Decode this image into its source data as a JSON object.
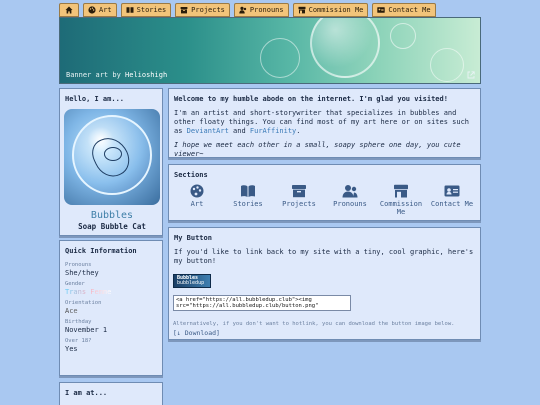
{
  "nav": [
    {
      "label": "",
      "icon": "home-icon"
    },
    {
      "label": "Art",
      "icon": "palette-icon"
    },
    {
      "label": "Stories",
      "icon": "book-icon"
    },
    {
      "label": "Projects",
      "icon": "box-icon"
    },
    {
      "label": "Pronouns",
      "icon": "people-icon"
    },
    {
      "label": "Commission Me",
      "icon": "store-icon"
    },
    {
      "label": "Contact Me",
      "icon": "id-card-icon"
    }
  ],
  "banner": {
    "credit_prefix": "Banner art by",
    "credit_name": "Helioshigh"
  },
  "profile": {
    "heading": "Hello, I am...",
    "name": "Bubbles",
    "subtitle": "Soap Bubble Cat"
  },
  "quick_info": {
    "heading": "Quick Information",
    "items": [
      {
        "key": "Pronouns",
        "value": "She/they"
      },
      {
        "key": "Gender",
        "value": "Trans Femme"
      },
      {
        "key": "Orientation",
        "value": "Ace"
      },
      {
        "key": "Birthday",
        "value": "November 1"
      },
      {
        "key": "Over 18?",
        "value": "Yes"
      }
    ]
  },
  "iam": {
    "heading": "I am at..."
  },
  "welcome": {
    "heading": "Welcome to my humble abode on the internet. I'm glad you visited!",
    "p1_a": "I'm an artist and short-storywriter that specializes in bubbles and other floaty things. You can find most of my art here or on sites such as",
    "link1": "DeviantArt",
    "and": "and",
    "link2": "FurAffinity",
    "p1_end": ".",
    "p2": "I hope we meet each other in a small, soapy sphere one day, you cute viewer~"
  },
  "sections": {
    "heading": "Sections",
    "items": [
      {
        "label": "Art",
        "icon": "palette-icon"
      },
      {
        "label": "Stories",
        "icon": "book-icon"
      },
      {
        "label": "Projects",
        "icon": "box-icon"
      },
      {
        "label": "Pronouns",
        "icon": "people-icon"
      },
      {
        "label": "Commission Me",
        "icon": "store-icon"
      },
      {
        "label": "Contact Me",
        "icon": "id-card-icon"
      }
    ]
  },
  "mybutton": {
    "heading": "My Button",
    "text": "If you'd like to link back to my site with a tiny, cool graphic, here's my button!",
    "img_line1": "Bubbles",
    "img_line2": "bubbledup",
    "code": "<a href=\"https://all.bubbledup.club\"><img src=\"https://all.bubbledup.club/button.png\"",
    "alt_note": "Alternatively, if you don't want to hotlink, you can download the button image below.",
    "download": "[↓ Download]"
  },
  "colors": {
    "background": "#a9c8f1",
    "nav_tab": "#f2c47a",
    "card": "#dfe9fb",
    "link": "#3b7bb8"
  }
}
